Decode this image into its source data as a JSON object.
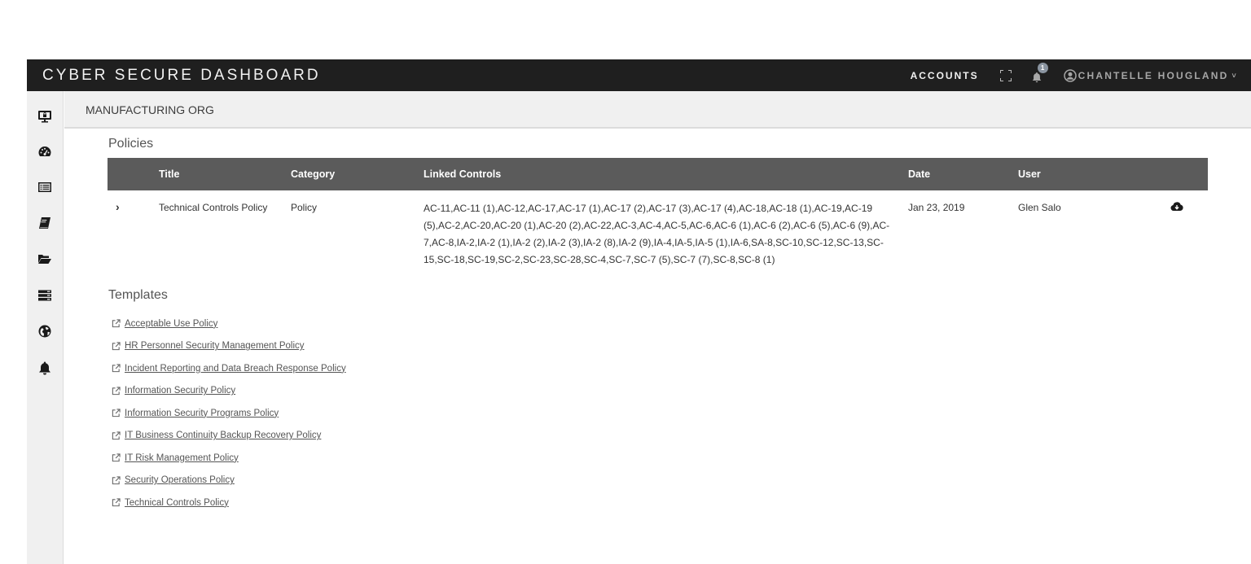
{
  "topbar": {
    "brand": "CYBER SECURE DASHBOARD",
    "accounts_label": "ACCOUNTS",
    "notification_count": "1",
    "user_name": "CHANTELLE HOUGLAND",
    "caret": "˅"
  },
  "sidebar": {
    "items": [
      {
        "icon": "monitor-lock-icon"
      },
      {
        "icon": "dashboard-gauge-icon"
      },
      {
        "icon": "list-icon"
      },
      {
        "icon": "book-icon"
      },
      {
        "icon": "folder-open-icon"
      },
      {
        "icon": "server-icon"
      },
      {
        "icon": "globe-icon"
      },
      {
        "icon": "bell-icon"
      }
    ]
  },
  "header": {
    "org_name": "MANUFACTURING ORG"
  },
  "policies": {
    "section_title": "Policies",
    "columns": [
      "Title",
      "Category",
      "Linked Controls",
      "Date",
      "User"
    ],
    "rows": [
      {
        "expand": "›",
        "title": "Technical Controls Policy",
        "category": "Policy",
        "linked_controls": "AC-11,AC-11 (1),AC-12,AC-17,AC-17 (1),AC-17 (2),AC-17 (3),AC-17 (4),AC-18,AC-18 (1),AC-19,AC-19 (5),AC-2,AC-20,AC-20 (1),AC-20 (2),AC-22,AC-3,AC-4,AC-5,AC-6,AC-6 (1),AC-6 (2),AC-6 (5),AC-6 (9),AC-7,AC-8,IA-2,IA-2 (1),IA-2 (2),IA-2 (3),IA-2 (8),IA-2 (9),IA-4,IA-5,IA-5 (1),IA-6,SA-8,SC-10,SC-12,SC-13,SC-15,SC-18,SC-19,SC-2,SC-23,SC-28,SC-4,SC-7,SC-7 (5),SC-7 (7),SC-8,SC-8 (1)",
        "date": "Jan 23, 2019",
        "user": "Glen Salo",
        "action_icon": "cloud-download-icon"
      }
    ]
  },
  "templates": {
    "section_title": "Templates",
    "items": [
      "Acceptable Use Policy",
      "HR Personnel Security Management Policy",
      "Incident Reporting and Data Breach Response Policy",
      "Information Security Policy",
      "Information Security Programs Policy",
      "IT Business Continuity Backup Recovery Policy",
      "IT Risk Management Policy",
      "Security Operations Policy",
      "Technical Controls Policy"
    ]
  }
}
